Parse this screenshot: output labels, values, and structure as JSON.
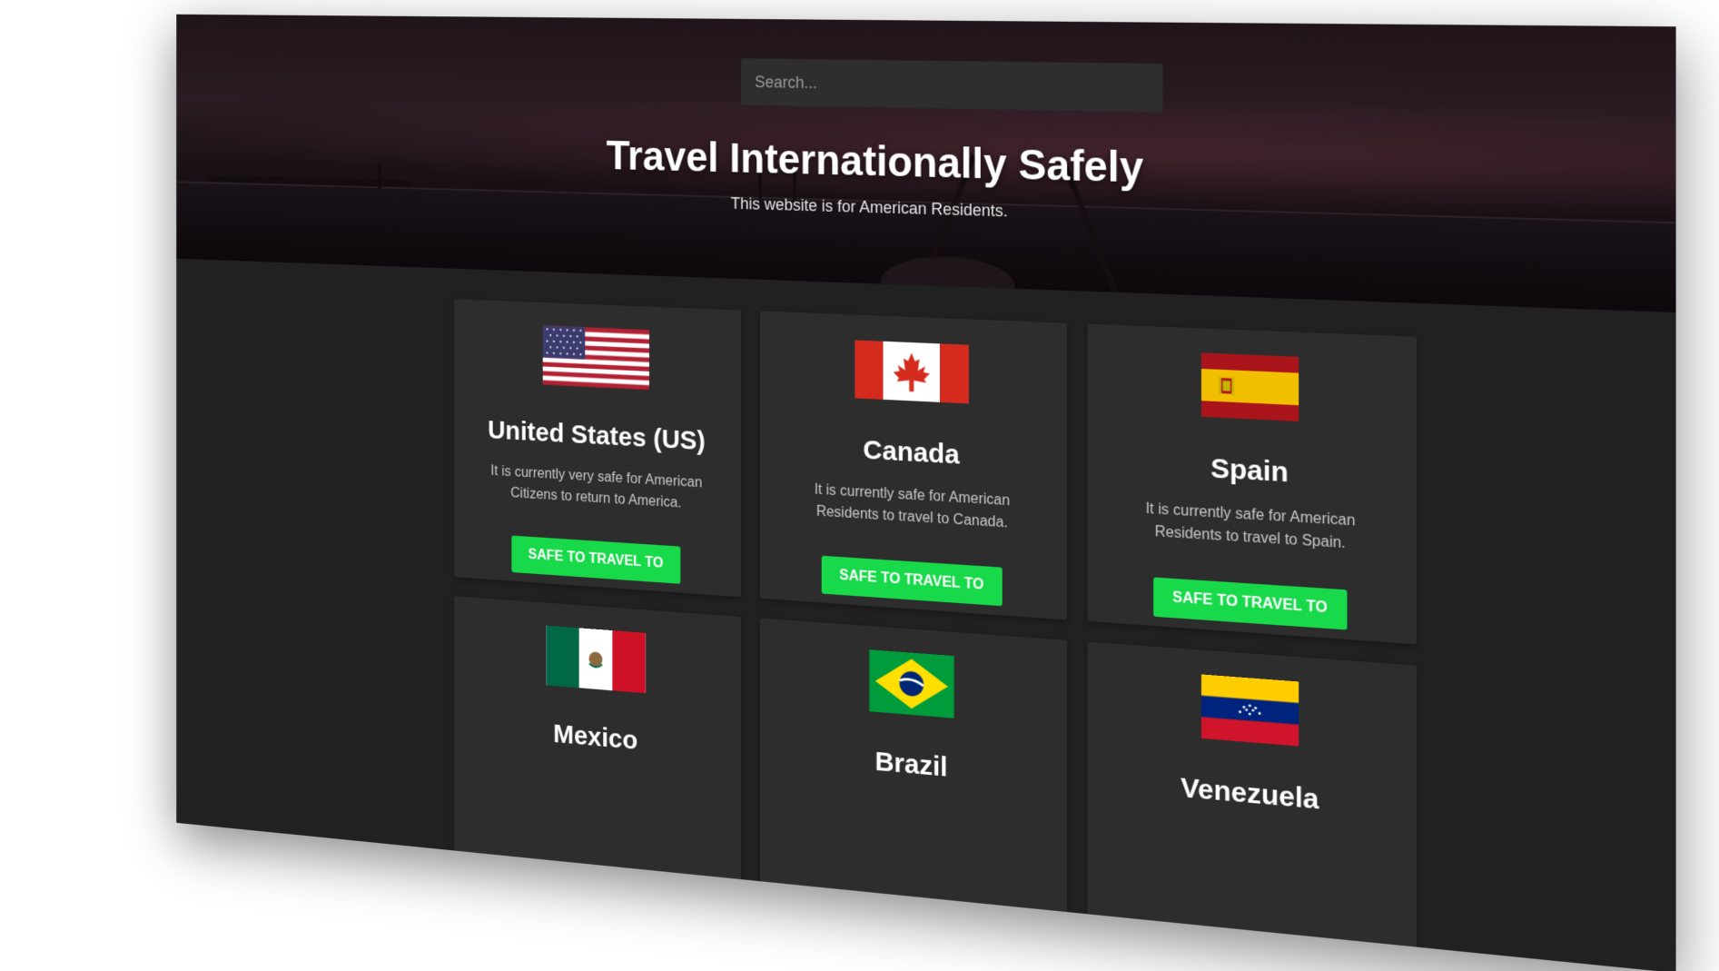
{
  "search": {
    "placeholder": "Search..."
  },
  "hero": {
    "title": "Travel Internationally Safely",
    "subtitle": "This website is for American Residents."
  },
  "countries": [
    {
      "name": "United States (US)",
      "flag": "us-flag-icon",
      "description": "It is currently very safe for American Citizens to return to America.",
      "button": "SAFE TO TRAVEL TO"
    },
    {
      "name": "Canada",
      "flag": "canada-flag-icon",
      "description": "It is currently safe for American Residents to travel to Canada.",
      "button": "SAFE TO TRAVEL TO"
    },
    {
      "name": "Spain",
      "flag": "spain-flag-icon",
      "description": "It is currently safe for American Residents to travel to Spain.",
      "button": "SAFE TO TRAVEL TO"
    },
    {
      "name": "Mexico",
      "flag": "mexico-flag-icon"
    },
    {
      "name": "Brazil",
      "flag": "brazil-flag-icon"
    },
    {
      "name": "Venezuela",
      "flag": "venezuela-flag-icon"
    }
  ],
  "colors": {
    "background": "#212121",
    "card": "#2d2d2d",
    "button": "#18d94a",
    "text": "#ffffff"
  }
}
